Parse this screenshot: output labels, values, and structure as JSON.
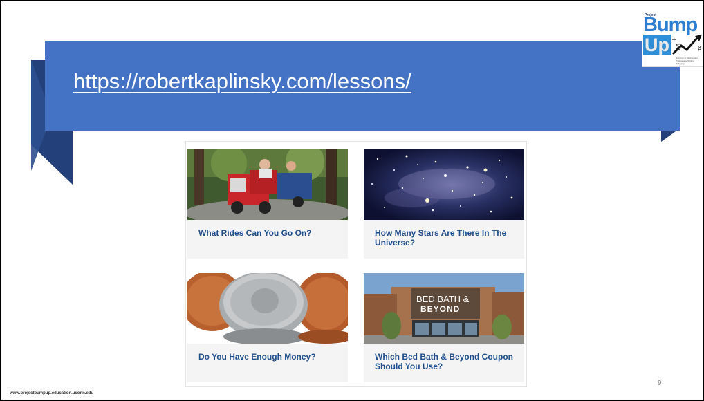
{
  "banner": {
    "url_text": "https://robertkaplinsky.com/lessons/"
  },
  "logo": {
    "top_text": "Project",
    "word1": "Bump",
    "word2": "Up",
    "tagline": "Building Up Mathematics Professional Writing Pedagogy"
  },
  "lessons": [
    {
      "title": "What Rides Can You Go On?",
      "image": "go-kart-ride-photo"
    },
    {
      "title": "How Many Stars Are There In The Universe?",
      "image": "star-field-photo"
    },
    {
      "title": "Do You Have Enough Money?",
      "image": "coins-photo"
    },
    {
      "title": "Which Bed Bath & Beyond Coupon Should You Use?",
      "image": "bed-bath-beyond-store-photo"
    }
  ],
  "store_sign": {
    "line1": "BED BATH &",
    "line2": "BEYOND"
  },
  "footer": {
    "website": "www.projectbumpup.education.uconn.edu"
  },
  "page_number": "9",
  "colors": {
    "banner": "#4472c4",
    "ribbon_dark": "#23407a",
    "card_title": "#1f4e8c"
  }
}
